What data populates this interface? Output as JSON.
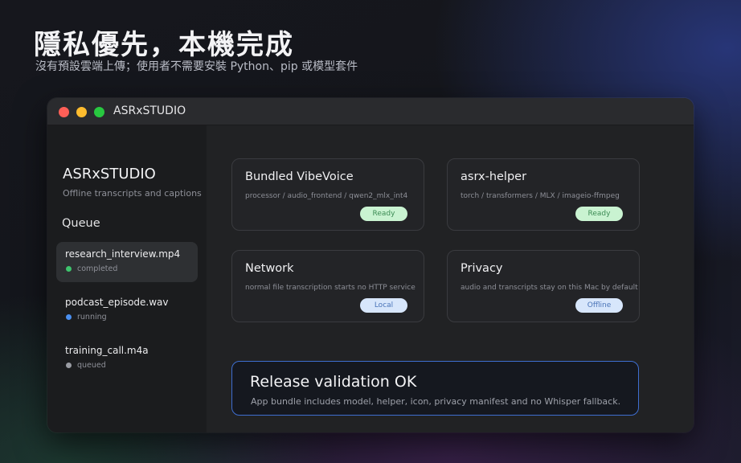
{
  "hero": {
    "title": "隱私優先，本機完成",
    "subtitle": "沒有預設雲端上傳；使用者不需要安裝 Python、pip 或模型套件"
  },
  "window": {
    "title": "ASRxSTUDIO"
  },
  "sidebar": {
    "brand": "ASRxSTUDIO",
    "tagline": "Offline transcripts and captions",
    "queue_heading": "Queue",
    "items": [
      {
        "name": "research_interview.mp4",
        "status": "completed",
        "status_color": "#3ec46d",
        "selected": true
      },
      {
        "name": "podcast_episode.wav",
        "status": "running",
        "status_color": "#4a8ff0",
        "selected": false
      },
      {
        "name": "training_call.m4a",
        "status": "queued",
        "status_color": "#9a9ca3",
        "selected": false
      }
    ]
  },
  "cards": [
    {
      "title": "Bundled VibeVoice",
      "desc": "processor / audio_frontend / qwen2_mlx_int4",
      "badge": "Ready",
      "badge_style": "green"
    },
    {
      "title": "asrx-helper",
      "desc": "torch / transformers / MLX / imageio-ffmpeg",
      "badge": "Ready",
      "badge_style": "green"
    },
    {
      "title": "Network",
      "desc": "normal file transcription starts no HTTP service",
      "badge": "Local",
      "badge_style": "blue"
    },
    {
      "title": "Privacy",
      "desc": "audio and transcripts stay on this Mac by default",
      "badge": "Offline",
      "badge_style": "blue"
    }
  ],
  "release": {
    "title": "Release validation OK",
    "desc": "App bundle includes model, helper, icon, privacy manifest and no Whisper fallback."
  },
  "colors": {
    "accent_border": "#3e6ed0",
    "ready_badge": "#c9f3d1",
    "info_badge": "#d7e6fb"
  }
}
